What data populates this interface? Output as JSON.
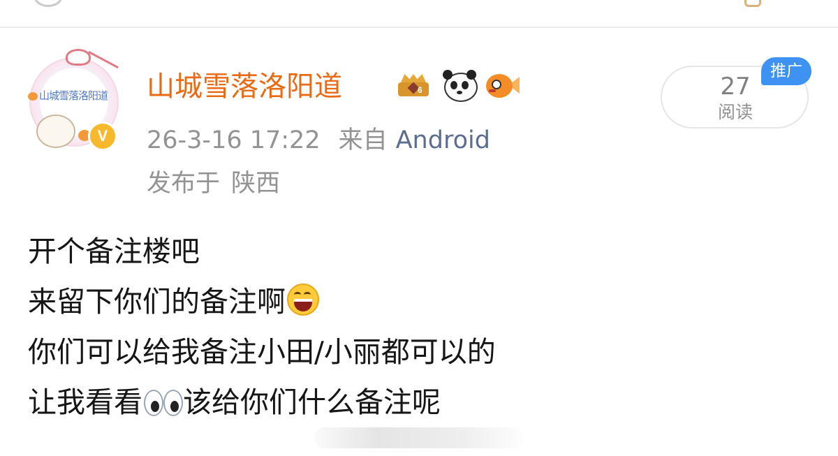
{
  "post": {
    "author": {
      "name": "山城雪落洛阳道",
      "avatar_text": "山城雪落洛阳道",
      "verified_label": "V",
      "badge_icons": [
        "crown-icon",
        "panda-icon",
        "goldfish-icon"
      ],
      "crown_level": "6"
    },
    "meta": {
      "timestamp": "26-3-16 17:22",
      "source_prefix": "来自",
      "source_device": "Android",
      "location_prefix": "发布于",
      "location": "陕西"
    },
    "reads": {
      "count": "27",
      "label": "阅读"
    },
    "promo_tag": "推广",
    "content": {
      "line1": "开个备注楼吧",
      "line2": "来留下你们的备注啊",
      "line3": "你们可以给我备注小田/小丽都可以的",
      "line4_before": "让我看看",
      "line4_after": "该给你们什么备注呢"
    }
  },
  "colors": {
    "username": "#ea6a14",
    "meta_gray": "#939393",
    "device_link": "#5b6e8f",
    "promo_blue": "#3e92f1",
    "verified_gold": "#f8b82c"
  }
}
